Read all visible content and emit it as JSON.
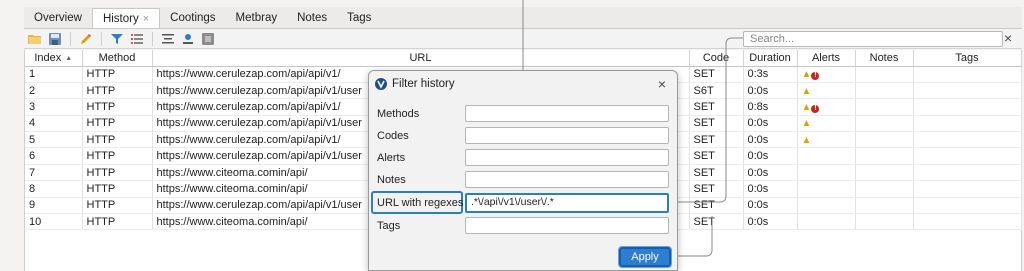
{
  "tabs": [
    {
      "label": "Overview"
    },
    {
      "label": "History",
      "close": "×"
    },
    {
      "label": "Cootings"
    },
    {
      "label": "Metbray"
    },
    {
      "label": "Notes"
    },
    {
      "label": "Tags"
    }
  ],
  "search": {
    "placeholder": "Search...",
    "clear": "×"
  },
  "table": {
    "columns": [
      "Index",
      "Method",
      "URL",
      "Code",
      "Duration",
      "Alerts",
      "Notes",
      "Tags"
    ],
    "rows": [
      {
        "index": "1",
        "method": "HTTP",
        "url": "https://www.cerulezap.com/api/api/v1/",
        "code": "SET",
        "duration": "0:3s",
        "alerts": "warn-error"
      },
      {
        "index": "2",
        "method": "HTTP",
        "url": "https://www.cerulezap.com/api/api/v1/user",
        "code": "S6T",
        "duration": "0:0s",
        "alerts": "warn"
      },
      {
        "index": "3",
        "method": "HTTP",
        "url": "https://www.cerulezap.com/api/api/v1/",
        "code": "SET",
        "duration": "0:8s",
        "alerts": "warn-error"
      },
      {
        "index": "4",
        "method": "HTTP",
        "url": "https://www.cerulezap.com/api/api/v1/user",
        "code": "SET",
        "duration": "0:0s",
        "alerts": "warn"
      },
      {
        "index": "5",
        "method": "HTTP",
        "url": "https://www.cerulezap.com/api/api/v1/",
        "code": "SET",
        "duration": "0:0s",
        "alerts": "warn"
      },
      {
        "index": "6",
        "method": "HTTP",
        "url": "https://www.cerulezap.com/api/api/v1/user",
        "code": "SET",
        "duration": "0:0s",
        "alerts": ""
      },
      {
        "index": "7",
        "method": "HTTP",
        "url": "https://www.citeoma.comin/api/",
        "code": "SET",
        "duration": "0:0s",
        "alerts": ""
      },
      {
        "index": "8",
        "method": "HTTP",
        "url": "https://www.citeoma.comin/api/",
        "code": "SET",
        "duration": "0:0s",
        "alerts": ""
      },
      {
        "index": "9",
        "method": "HTTP",
        "url": "https://www.cerulezap.com/api/api/v1/user",
        "code": "SET",
        "duration": "0:0s",
        "alerts": ""
      },
      {
        "index": "10",
        "method": "HTTP",
        "url": "https://www.citeoma.comin/api/",
        "code": "SET",
        "duration": "0:0s",
        "alerts": ""
      }
    ]
  },
  "dialog": {
    "title": "Filter history",
    "close": "×",
    "fields": [
      {
        "label": "Methods",
        "value": ""
      },
      {
        "label": "Codes",
        "value": ""
      },
      {
        "label": "Alerts",
        "value": ""
      },
      {
        "label": "Notes",
        "value": ""
      },
      {
        "label": "URL with regexes",
        "value": ".*\\/api\\/v1\\/user\\/.*"
      },
      {
        "label": "Tags",
        "value": ""
      }
    ],
    "apply_label": "Apply"
  },
  "colors": {
    "accent": "#2d7ed0",
    "warn": "#e0a100",
    "error": "#c8261b"
  }
}
